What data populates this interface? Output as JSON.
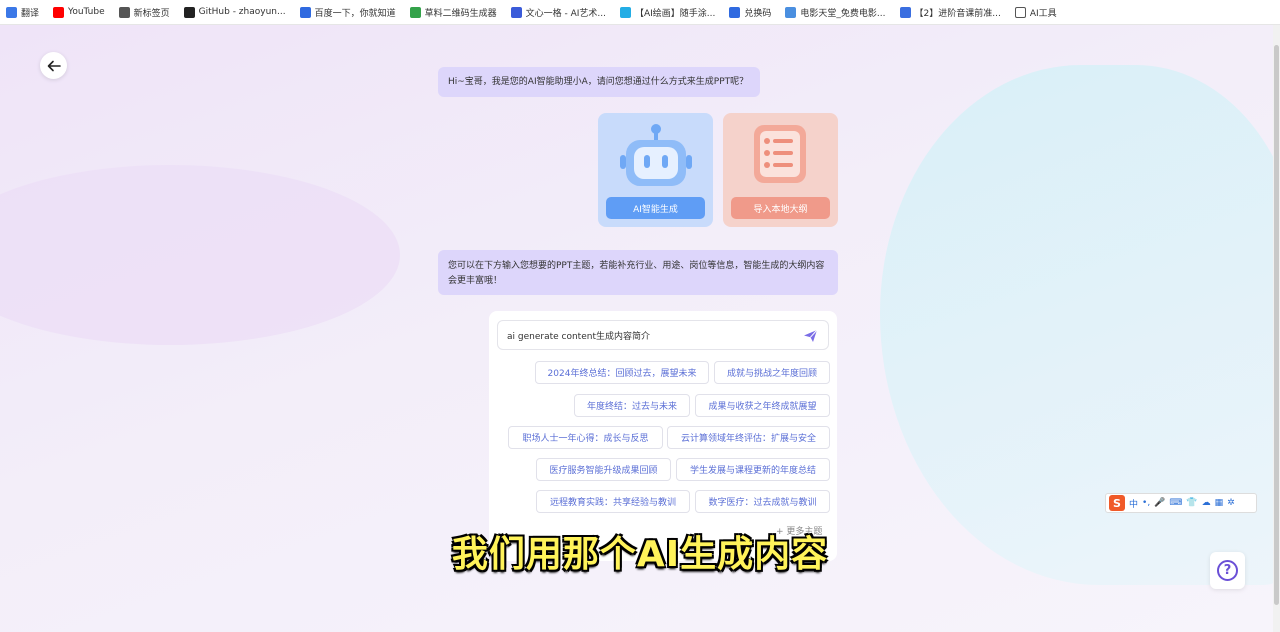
{
  "bookmarks": [
    {
      "label": "翻译",
      "icon": "translate-icon",
      "color": "#3b78e7"
    },
    {
      "label": "YouTube",
      "icon": "youtube-icon",
      "color": "#ff0000"
    },
    {
      "label": "新标签页",
      "icon": "globe-icon",
      "color": "#555555"
    },
    {
      "label": "GitHub - zhaoyun...",
      "icon": "github-icon",
      "color": "#222222"
    },
    {
      "label": "百度一下，你就知道",
      "icon": "baidu-icon",
      "color": "#2f6ae0"
    },
    {
      "label": "草料二维码生成器",
      "icon": "qrcode-icon",
      "color": "#33a24a"
    },
    {
      "label": "文心一格 - AI艺术...",
      "icon": "wenxin-icon",
      "color": "#3a5bd9"
    },
    {
      "label": "【AI绘画】随手涂...",
      "icon": "bilibili-icon",
      "color": "#23ade5"
    },
    {
      "label": "兑换码",
      "icon": "check-icon",
      "color": "#2f6ae0"
    },
    {
      "label": "电影天堂_免费电影...",
      "icon": "movie-icon",
      "color": "#4a8fe0"
    },
    {
      "label": "【2】进阶音课前准...",
      "icon": "doc-icon",
      "color": "#3a6ee0"
    },
    {
      "label": "AI工具",
      "icon": "folder-icon",
      "color": "#555555"
    }
  ],
  "chat": {
    "greeting": "Hi~宝哥，我是您的AI智能助理小A，请问您想通过什么方式来生成PPT呢？",
    "hint": "您可以在下方输入您想要的PPT主题，若能补充行业、用途、岗位等信息，智能生成的大纲内容会更丰富哦！"
  },
  "cards": {
    "ai_label": "AI智能生成",
    "import_label": "导入本地大纲"
  },
  "input": {
    "value": "ai generate content生成内容简介"
  },
  "suggestions": [
    "2024年终总结：回顾过去，展望未来",
    "成就与挑战之年度回顾",
    "年度终结：过去与未来",
    "成果与收获之年终成就展望",
    "职场人士一年心得：成长与反思",
    "云计算领域年终评估：扩展与安全",
    "医疗服务智能升级成果回顾",
    "学生发展与课程更新的年度总结",
    "远程教育实践：共享经验与教训",
    "数字医疗：过去成就与教训"
  ],
  "more_label": "+ 更多主题",
  "subtitle": "我们用那个AI生成内容",
  "ime": {
    "logo": "S",
    "lang": "中"
  },
  "help": {
    "symbol": "?"
  }
}
